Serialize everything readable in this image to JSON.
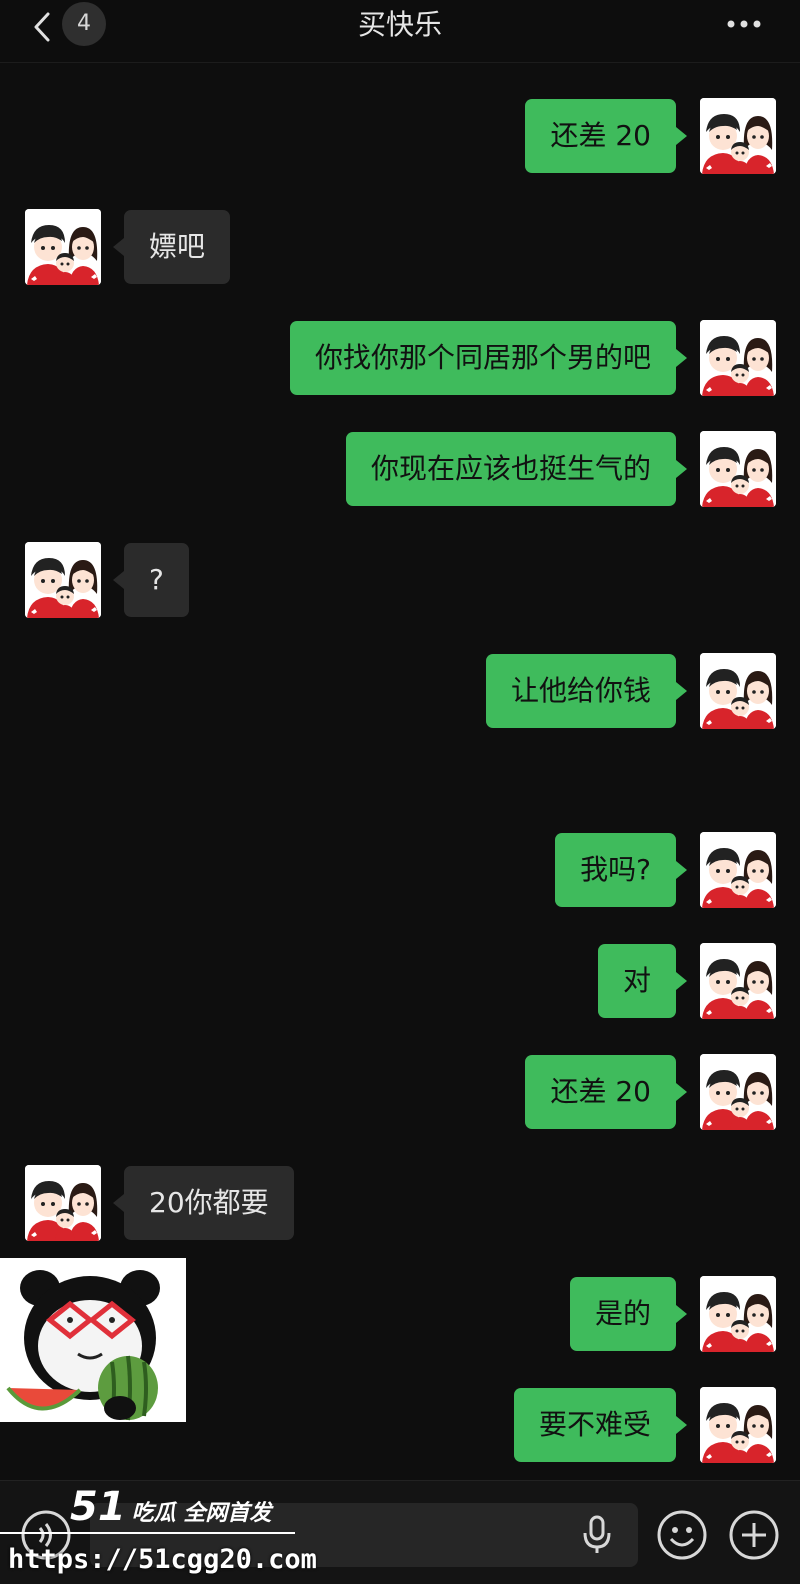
{
  "header": {
    "title": "买快乐",
    "unread_count": "4"
  },
  "messages": [
    {
      "side": "out",
      "text": "还差 20"
    },
    {
      "side": "in",
      "text": "嫖吧"
    },
    {
      "side": "out",
      "text": "你找你那个同居那个男的吧"
    },
    {
      "side": "out",
      "text": "你现在应该也挺生气的"
    },
    {
      "side": "in",
      "text": "?"
    },
    {
      "side": "out",
      "text": "让他给你钱"
    },
    {
      "side": "out",
      "text": "我吗?"
    },
    {
      "side": "out",
      "text": "对"
    },
    {
      "side": "out",
      "text": "还差 20"
    },
    {
      "side": "in",
      "text": "20你都要"
    },
    {
      "side": "out",
      "text": "是的"
    },
    {
      "side": "out",
      "text": "要不难受"
    }
  ],
  "watermark": {
    "logo_number": "51",
    "logo_text": "吃瓜 全网首发",
    "url": "https://51cgg20.com"
  },
  "icons": {
    "back": "chevron-left-icon",
    "more": "more-dots-icon",
    "voice": "voice-mode-icon",
    "mic": "microphone-icon",
    "emoji": "emoji-icon",
    "plus": "plus-icon"
  },
  "colors": {
    "outgoing_bubble": "#3fbb5c",
    "incoming_bubble": "#2b2b2b",
    "background": "#0e0e0e"
  }
}
